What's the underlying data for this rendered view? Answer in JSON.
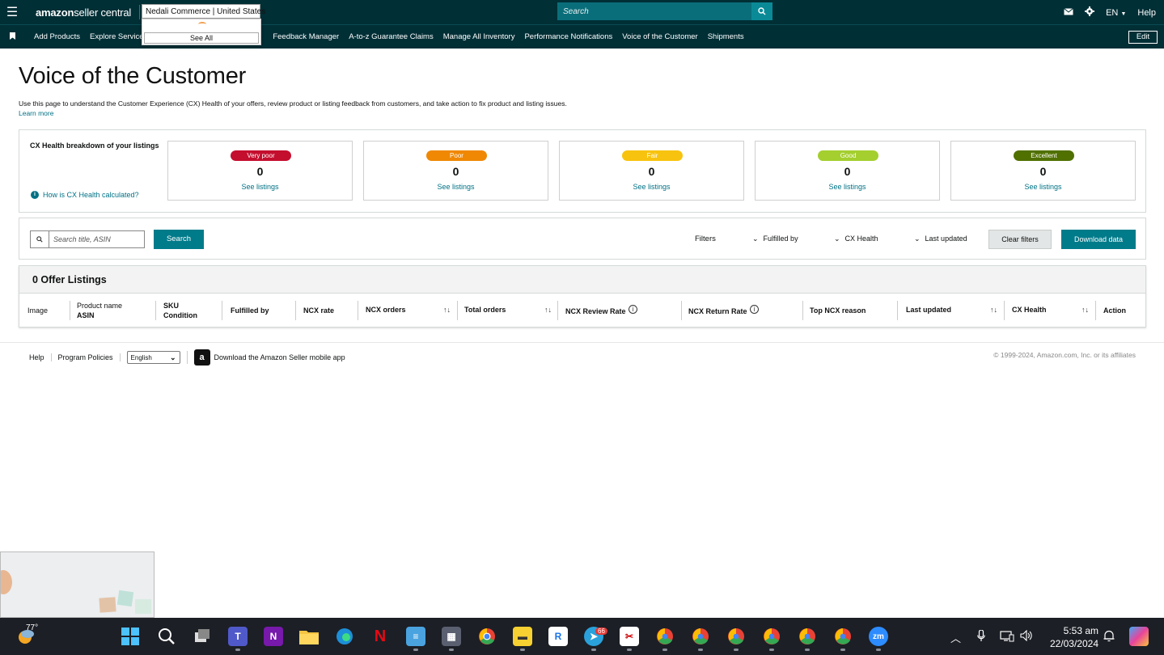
{
  "topbar": {
    "brand_prefix": "amazon",
    "brand_suffix": " seller central",
    "account": "Nedali Commerce | United States",
    "account_dropdown_see_all": "See All",
    "search_placeholder": "Search",
    "language": "EN",
    "help": "Help"
  },
  "navbar": {
    "items": [
      "Add Products",
      "Explore Services",
      "Feedback Manager",
      "A-to-z Guarantee Claims",
      "Manage All Inventory",
      "Performance Notifications",
      "Voice of the Customer",
      "Shipments"
    ],
    "edit": "Edit"
  },
  "page": {
    "title": "Voice of the Customer",
    "description": "Use this page to understand the Customer Experience (CX) Health of your offers, review product or listing feedback from customers, and take action to fix product and listing issues.",
    "learn_more": "Learn more"
  },
  "cx_health": {
    "title": "CX Health breakdown of your listings",
    "how_link": "How is CX Health calculated?",
    "cards": [
      {
        "label": "Very poor",
        "count": "0",
        "link": "See listings",
        "color": "#c40e2e"
      },
      {
        "label": "Poor",
        "count": "0",
        "link": "See listings",
        "color": "#f08804"
      },
      {
        "label": "Fair",
        "count": "0",
        "link": "See listings",
        "color": "#f8c30e"
      },
      {
        "label": "Good",
        "count": "0",
        "link": "See listings",
        "color": "#a4cf2f"
      },
      {
        "label": "Excellent",
        "count": "0",
        "link": "See listings",
        "color": "#507000"
      }
    ]
  },
  "filters": {
    "search_placeholder": "Search title, ASIN",
    "search_button": "Search",
    "label": "Filters",
    "fulfilled_by": "Fulfilled by",
    "cx_health": "CX Health",
    "last_updated": "Last updated",
    "clear": "Clear filters",
    "download": "Download data"
  },
  "table": {
    "title": "0 Offer Listings",
    "columns": {
      "image": "Image",
      "product_name": "Product name",
      "asin": "ASIN",
      "sku": "SKU",
      "condition": "Condition",
      "fulfilled_by": "Fulfilled by",
      "ncx_rate": "NCX rate",
      "ncx_orders": "NCX orders",
      "total_orders": "Total orders",
      "ncx_review_rate": "NCX Review Rate",
      "ncx_return_rate": "NCX Return Rate",
      "top_ncx_reason": "Top NCX reason",
      "last_updated": "Last updated",
      "cx_health": "CX Health",
      "action": "Action"
    }
  },
  "footer": {
    "help": "Help",
    "program_policies": "Program Policies",
    "language": "English",
    "app_text": "Download the Amazon Seller mobile app",
    "copyright": "© 1999-2024, Amazon.com, Inc. or its affiliates"
  },
  "taskbar": {
    "temperature": "77°",
    "telegram_badge": "66",
    "time": "5:53 am",
    "date": "22/03/2024"
  }
}
